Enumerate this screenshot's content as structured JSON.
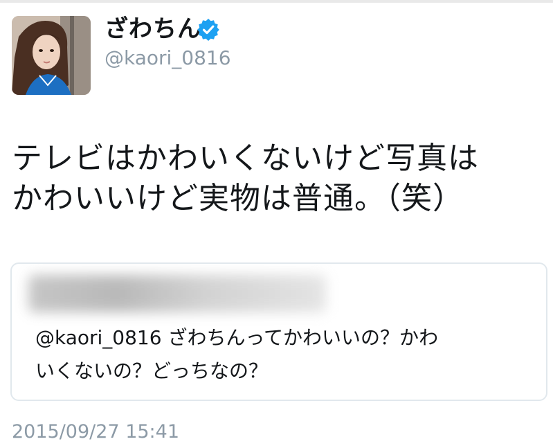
{
  "user": {
    "display_name": "ざわちん",
    "handle": "@kaori_0816",
    "avatar": "avatar-photo",
    "verified_icon": "verified-badge-icon"
  },
  "tweet": {
    "text": "テレビはかわいくないけど写真は\nかわいいけど実物は普通。（笑）",
    "timestamp": "2015/09/27 15:41"
  },
  "quoted_tweet": {
    "author_blurred": true,
    "text": "@kaori_0816 ざわちんってかわいいの？かわ\nいくないの？どっちなの？"
  },
  "colors": {
    "verified_blue": "#1da1f2",
    "secondary_text": "#8c9aa6",
    "border": "#e1e8ed"
  }
}
